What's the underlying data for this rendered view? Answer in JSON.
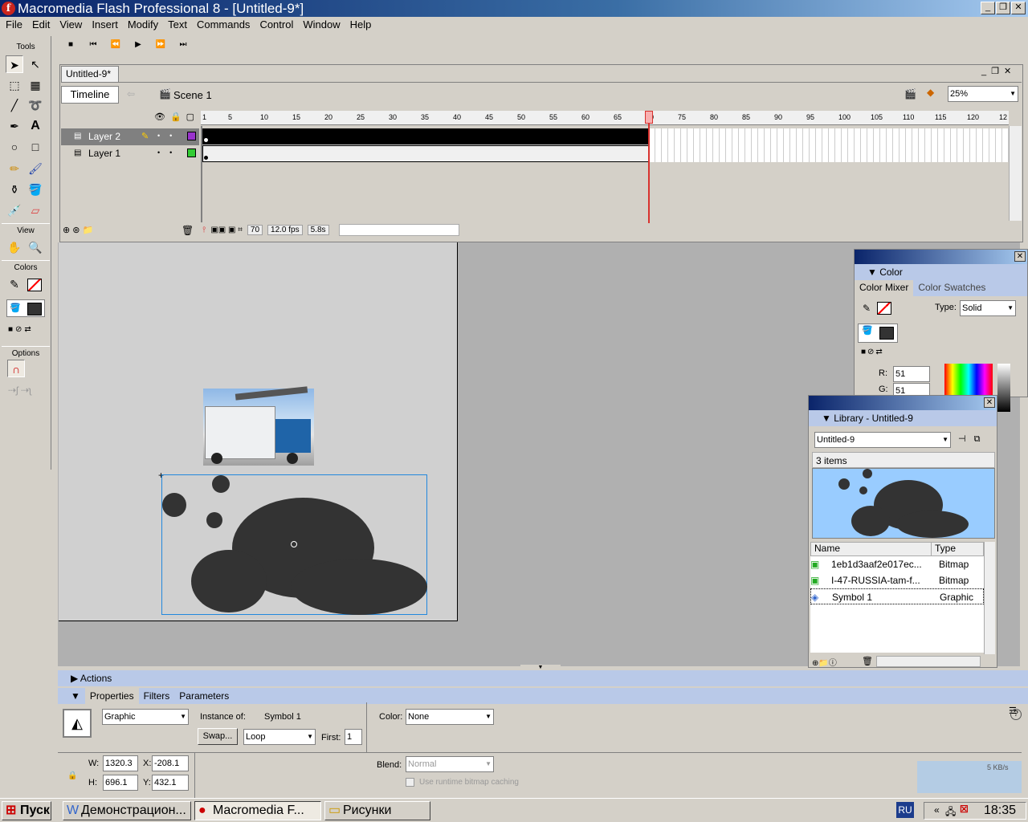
{
  "window": {
    "title": "Macromedia Flash Professional 8 - [Untitled-9*]"
  },
  "menu": [
    "File",
    "Edit",
    "View",
    "Insert",
    "Modify",
    "Text",
    "Commands",
    "Control",
    "Window",
    "Help"
  ],
  "tools": {
    "header": "Tools",
    "view": "View",
    "colors": "Colors",
    "options": "Options"
  },
  "document": {
    "tab": "Untitled-9*",
    "timeline_button": "Timeline",
    "scene": "Scene 1",
    "zoom": "25%"
  },
  "timeline": {
    "ruler": [
      "1",
      "5",
      "10",
      "15",
      "20",
      "25",
      "30",
      "35",
      "40",
      "45",
      "50",
      "55",
      "60",
      "65",
      "70",
      "75",
      "80",
      "85",
      "90",
      "95",
      "100",
      "105",
      "110",
      "115",
      "120",
      "12"
    ],
    "layers": [
      {
        "name": "Layer 2",
        "color": "#9933cc"
      },
      {
        "name": "Layer 1",
        "color": "#33cc33"
      }
    ],
    "current_frame": "70",
    "fps": "12.0 fps",
    "time": "5.8s"
  },
  "color_panel": {
    "title": "Color",
    "tab_mixer": "Color Mixer",
    "tab_swatches": "Color Swatches",
    "type_label": "Type:",
    "type_value": "Solid",
    "r_label": "R:",
    "r_value": "51",
    "g_label": "G:",
    "g_value": "51"
  },
  "library": {
    "title": "Library - Untitled-9",
    "doc": "Untitled-9",
    "count": "3 items",
    "col_name": "Name",
    "col_type": "Type",
    "items": [
      {
        "name": "1eb1d3aaf2e017ec...",
        "type": "Bitmap"
      },
      {
        "name": "I-47-RUSSIA-tam-f...",
        "type": "Bitmap"
      },
      {
        "name": "Symbol 1",
        "type": "Graphic"
      }
    ]
  },
  "properties": {
    "actions": "Actions",
    "tab_props": "Properties",
    "tab_filters": "Filters",
    "tab_params": "Parameters",
    "kind": "Graphic",
    "instance_label": "Instance of:",
    "instance": "Symbol 1",
    "swap": "Swap...",
    "loop": "Loop",
    "first_label": "First:",
    "first": "1",
    "color_label": "Color:",
    "color_value": "None",
    "w_label": "W:",
    "w": "1320.3",
    "h_label": "H:",
    "h": "696.1",
    "x_label": "X:",
    "x": "-208.1",
    "y_label": "Y:",
    "y": "432.1",
    "blend_label": "Blend:",
    "blend": "Normal",
    "cache": "Use runtime bitmap caching",
    "net": "5 KB/s"
  },
  "taskbar": {
    "start": "Пуск",
    "task1": "Демонстрацион...",
    "task2": "Macromedia F...",
    "task3": "Рисунки",
    "lang": "RU",
    "clock": "18:35"
  }
}
